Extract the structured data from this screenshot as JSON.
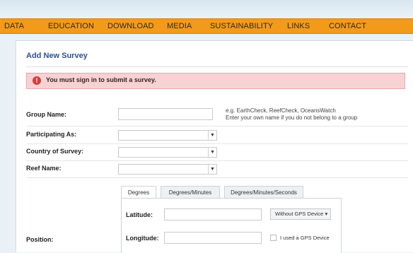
{
  "nav": {
    "items": [
      "DATA",
      "EDUCATION",
      "DOWNLOAD",
      "MEDIA",
      "SUSTAINABILITY",
      "LINKS",
      "CONTACT"
    ],
    "bar_color": "#f39a1a"
  },
  "form": {
    "title": "Add New Survey",
    "alert": "You must sign in to submit a survey.",
    "group_name": {
      "label": "Group Name:",
      "value": "",
      "hint_line1": "e.g. EarthCheck, ReefCheck, OceansWatch",
      "hint_line2": "Enter your own name if you do not belong to a group"
    },
    "participating_as": {
      "label": "Participating As:",
      "value": ""
    },
    "country": {
      "label": "Country of Survey:",
      "value": ""
    },
    "reef_name": {
      "label": "Reef Name:",
      "value": ""
    },
    "position": {
      "label": "Position:",
      "tabs": [
        "Degrees",
        "Degrees/Minutes",
        "Degrees/Minutes/Seconds"
      ],
      "active_tab": "Degrees",
      "latitude_label": "Latitude:",
      "latitude_value": "",
      "longitude_label": "Longitude:",
      "longitude_value": "",
      "gps_button": "Without GPS Device",
      "gps_checkbox_label": "I used a GPS Device"
    }
  },
  "icons": {
    "alert": "alert-icon",
    "dropdown": "chevron-down-icon"
  }
}
